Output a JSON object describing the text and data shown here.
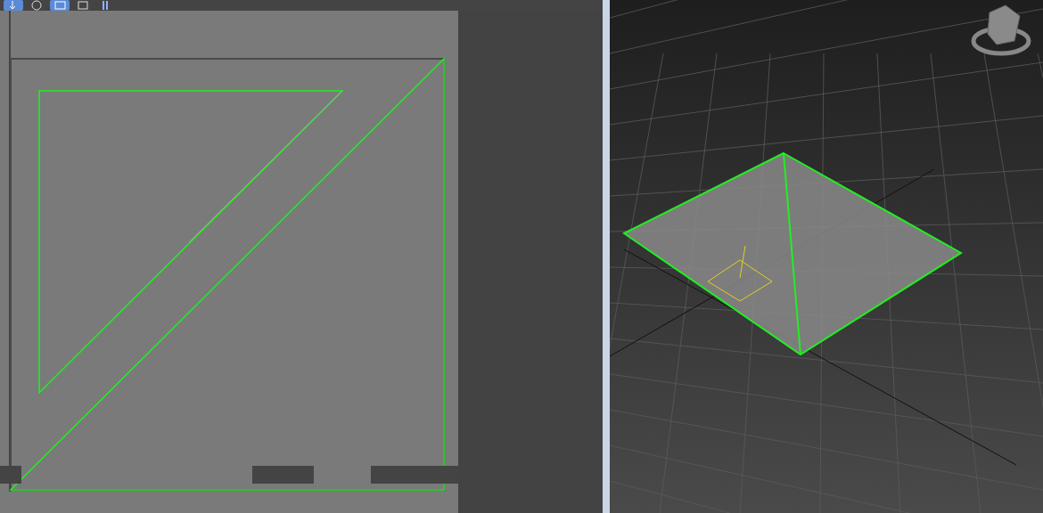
{
  "uv_editor": {
    "toolbar": [
      {
        "kind": "move",
        "selected": true
      },
      {
        "kind": "rotate",
        "selected": false
      },
      {
        "kind": "scale",
        "selected": true
      },
      {
        "kind": "freeform",
        "selected": false
      },
      {
        "kind": "mirror",
        "selected": false
      }
    ]
  },
  "viewport": {
    "view_cube": true
  }
}
